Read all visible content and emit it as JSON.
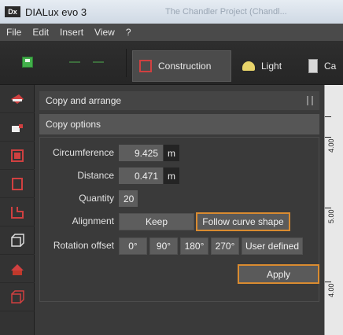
{
  "window": {
    "title": "DIALux evo 3",
    "app_icon": "Dx",
    "faded_title": "The Chandler Project (Chandl..."
  },
  "menu": [
    "File",
    "Edit",
    "Insert",
    "View",
    "?"
  ],
  "toolbar": {
    "tabs": [
      {
        "label": "Construction",
        "icon": "cube-icon"
      },
      {
        "label": "Light",
        "icon": "lamp-icon"
      },
      {
        "label": "Ca",
        "icon": "calculator-icon"
      }
    ]
  },
  "panel": {
    "header": "Copy and arrange",
    "subheader": "Copy options",
    "circumference": {
      "label": "Circumference",
      "value": "9.425",
      "unit": "m"
    },
    "distance": {
      "label": "Distance",
      "value": "0.471",
      "unit": "m"
    },
    "quantity": {
      "label": "Quantity",
      "value": "20"
    },
    "alignment": {
      "label": "Alignment",
      "options": [
        "Keep",
        "Follow curve shape"
      ],
      "selected": "Follow curve shape"
    },
    "rotation": {
      "label": "Rotation offset",
      "options": [
        "0°",
        "90°",
        "180°",
        "270°",
        "User defined"
      ]
    },
    "apply_label": "Apply"
  },
  "ruler": {
    "labels": [
      "4.00",
      "5.00",
      "4.00"
    ]
  },
  "colors": {
    "accent": "#d98b30",
    "construction_red": "#d04040",
    "save_green": "#42b04a"
  }
}
